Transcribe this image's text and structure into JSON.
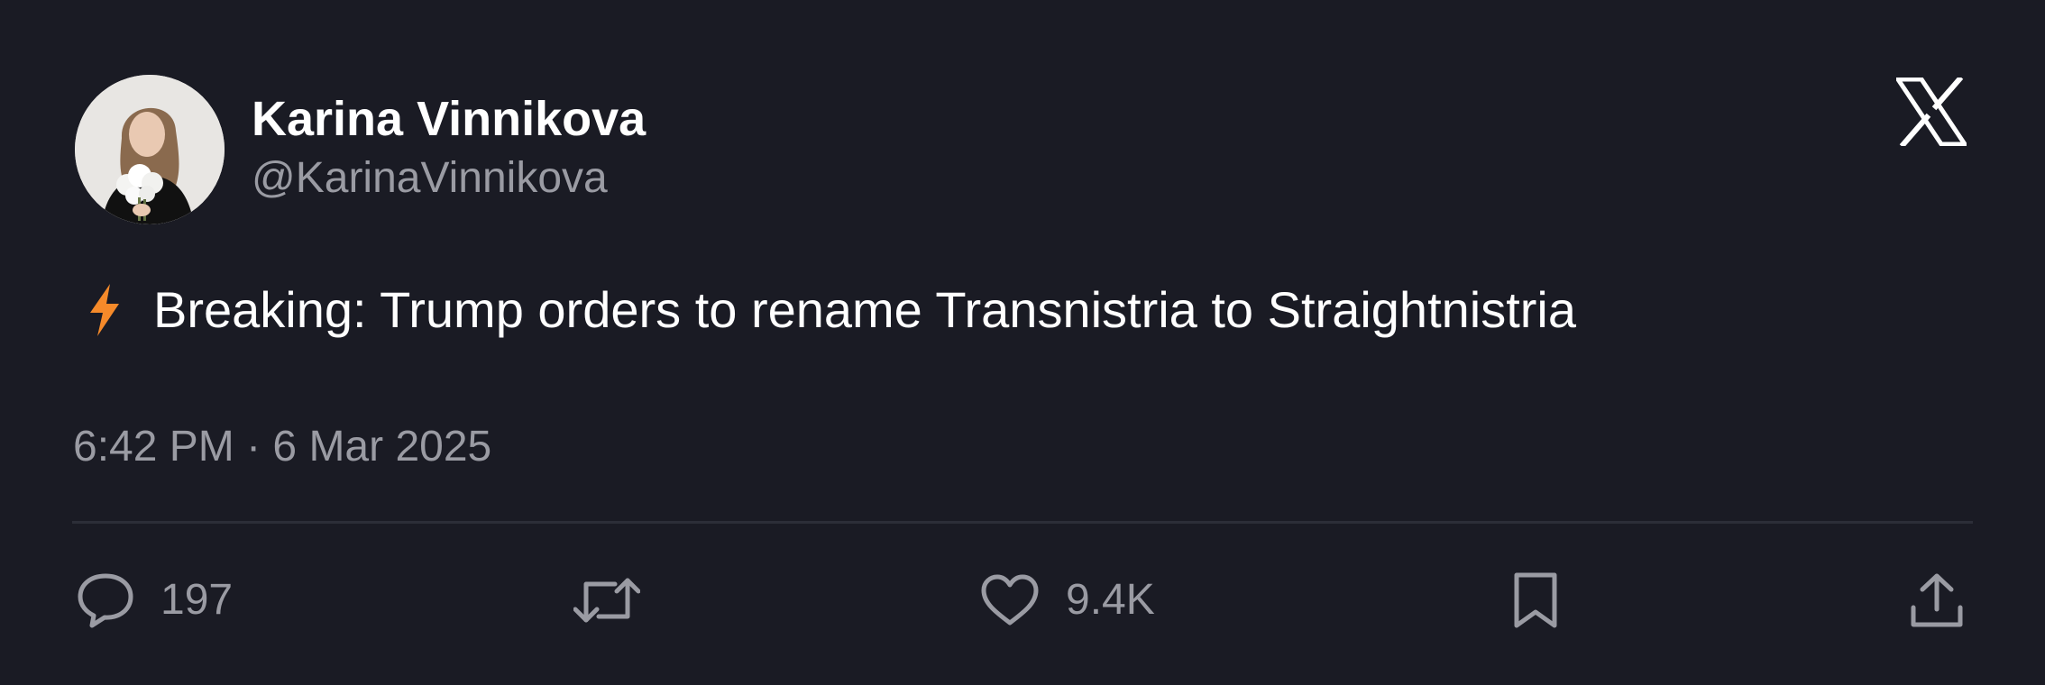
{
  "author": {
    "name": "Karina Vinnikova",
    "handle": "@KarinaVinnikova"
  },
  "tweet": {
    "prefix_icon": "lightning-bolt-icon",
    "text": "Breaking: Trump orders to rename Transnistria to Straightnistria",
    "timestamp": "6:42 PM · 6 Mar 2025"
  },
  "actions": {
    "reply_count": "197",
    "like_count": "9.4K"
  },
  "icons": {
    "brand": "x-logo-icon",
    "reply": "reply-icon",
    "repost": "repost-icon",
    "like": "heart-icon",
    "bookmark": "bookmark-icon",
    "share": "share-icon"
  },
  "colors": {
    "background": "#1a1b24",
    "primary_text": "#ffffff",
    "secondary_text": "#9a9ba3",
    "divider": "#2c2e38",
    "bolt": "#f58a2a"
  }
}
